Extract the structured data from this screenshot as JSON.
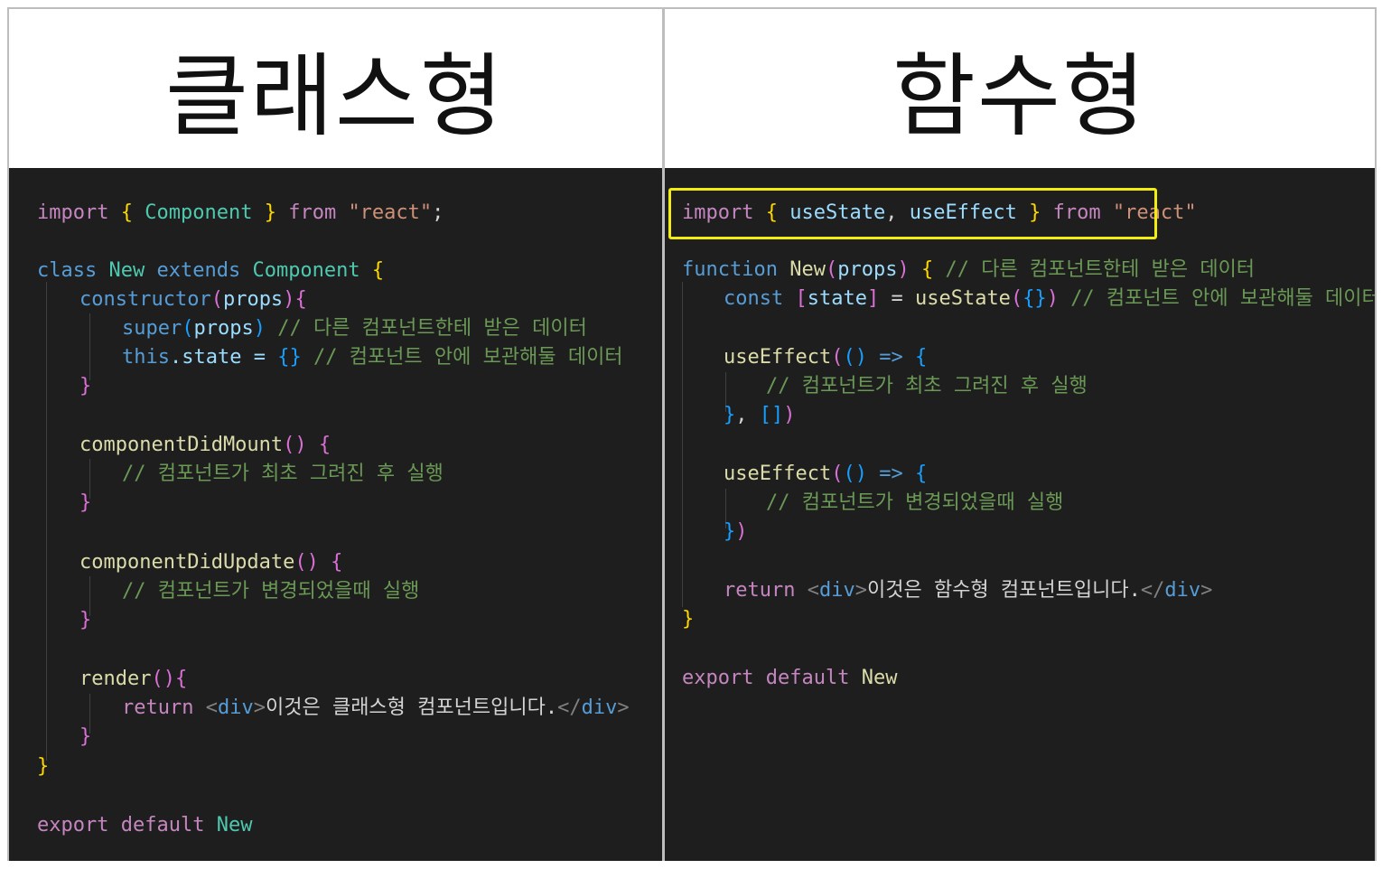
{
  "headers": {
    "left": "클래스형",
    "right": "함수형"
  },
  "class_code": {
    "l1": {
      "import": "import",
      "ob": "{",
      "name": "Component",
      "cb": "}",
      "from": "from",
      "str": "\"react\"",
      "semi": ";"
    },
    "l2": {
      "class": "class",
      "name": "New",
      "extends": "extends",
      "parent": "Component",
      "ob": "{"
    },
    "l3": {
      "ctor": "constructor",
      "op": "(",
      "props": "props",
      "cp": ")",
      "ob": "{"
    },
    "l4": {
      "super": "super",
      "op": "(",
      "props": "props",
      "cp": ")",
      "comment": "// 다른 컴포넌트한테 받은 데이터"
    },
    "l5": {
      "this": "this",
      "rest": ".state = ",
      "obj": "{}",
      "comment": "// 컴포넌트 안에 보관해둘 데이터"
    },
    "l6": {
      "cb": "}"
    },
    "l7": {
      "fn": "componentDidMount",
      "parens": "()",
      "ob": "{"
    },
    "l8": {
      "comment": "// 컴포넌트가 최초 그려진 후 실행"
    },
    "l9": {
      "cb": "}"
    },
    "l10": {
      "fn": "componentDidUpdate",
      "parens": "()",
      "ob": "{"
    },
    "l11": {
      "comment": "// 컴포넌트가 변경되었을때 실행"
    },
    "l12": {
      "cb": "}"
    },
    "l13": {
      "fn": "render",
      "parens": "()",
      "ob": "{"
    },
    "l14": {
      "ret": "return",
      "lt": "<",
      "tag": "div",
      "gt": ">",
      "text": "이것은 클래스형 컴포넌트입니다.",
      "lt2": "</",
      "tag2": "div",
      "gt2": ">"
    },
    "l15": {
      "cb": "}"
    },
    "l16": {
      "cb": "}"
    },
    "l17": {
      "export": "export",
      "default": "default",
      "name": "New"
    }
  },
  "func_code": {
    "l1": {
      "import": "import",
      "ob": "{",
      "a": "useState",
      "comma": ",",
      "b": "useEffect",
      "cb": "}",
      "from": "from",
      "str": "\"react\""
    },
    "l2": {
      "function": "function",
      "name": "New",
      "op": "(",
      "props": "props",
      "cp": ")",
      "ob": "{",
      "comment": "// 다른 컴포넌트한테 받은 데이터"
    },
    "l3": {
      "const": "const",
      "ob": "[",
      "state": "state",
      "cb": "]",
      "eq": " = ",
      "fn": "useState",
      "op": "(",
      "obj": "{}",
      "cp": ")",
      "comment": "// 컴포넌트 안에 보관해둘 데이터"
    },
    "l4": {
      "fn": "useEffect",
      "op": "(",
      "parens": "()",
      "arrow": "=>",
      "ob": "{"
    },
    "l5": {
      "comment": "// 컴포넌트가 최초 그려진 후 실행"
    },
    "l6": {
      "cb": "}",
      "comma": ",",
      "arr": "[]",
      "cp": ")"
    },
    "l7": {
      "fn": "useEffect",
      "op": "(",
      "parens": "()",
      "arrow": "=>",
      "ob": "{"
    },
    "l8": {
      "comment": "// 컴포넌트가 변경되었을때 실행"
    },
    "l9": {
      "cb": "}",
      "cp": ")"
    },
    "l10": {
      "ret": "return",
      "lt": "<",
      "tag": "div",
      "gt": ">",
      "text": "이것은 함수형 컴포넌트입니다.",
      "lt2": "</",
      "tag2": "div",
      "gt2": ">"
    },
    "l11": {
      "cb": "}"
    },
    "l12": {
      "export": "export",
      "default": "default",
      "name": "New"
    }
  },
  "colors": {
    "background": "#1e1e1e",
    "keyword": "#c586c0",
    "storage": "#569cd6",
    "function": "#dcdcaa",
    "class": "#4ec9b0",
    "string": "#ce9178",
    "comment": "#6a9955",
    "parameter": "#9cdcfe",
    "highlight_box": "#f2ec10"
  }
}
